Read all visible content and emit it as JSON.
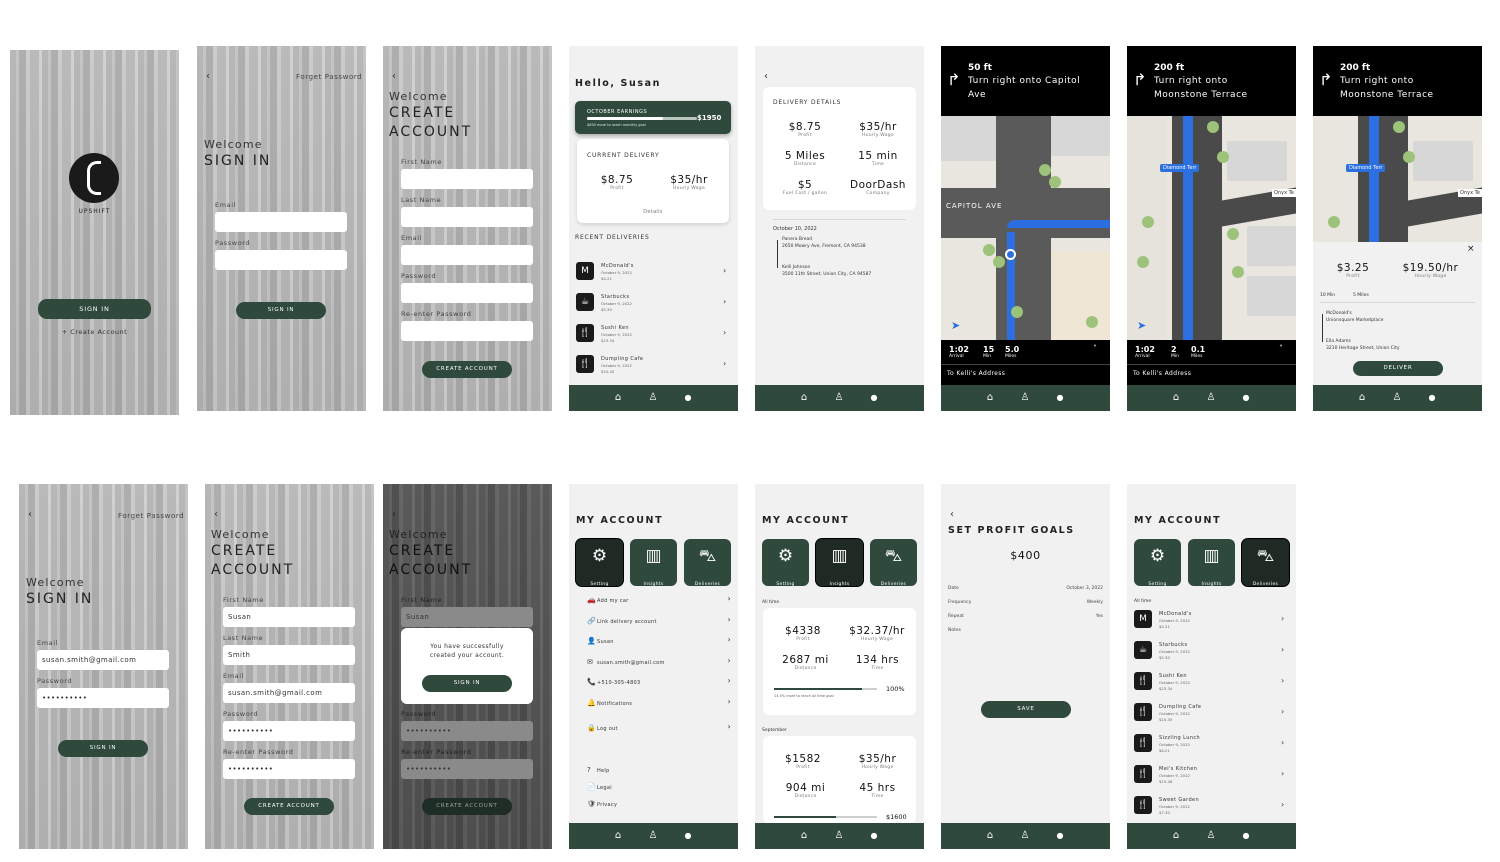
{
  "brand": {
    "name": "UPSHIFT",
    "accent": "#2f4a3c"
  },
  "s1": {
    "signin": "SIGN IN",
    "create": "+ Create Account"
  },
  "s2": {
    "back": "‹",
    "forgot": "Forget Password",
    "welcome": "Welcome",
    "title": "SIGN IN",
    "email_label": "Email",
    "password_label": "Password",
    "button": "SIGN IN"
  },
  "s3": {
    "back": "‹",
    "welcome": "Welcome",
    "title1": "CREATE",
    "title2": "ACCOUNT",
    "labels": [
      "First Name",
      "Last Name",
      "Email",
      "Password",
      "Re-enter Password"
    ],
    "button": "CREATE ACCOUNT"
  },
  "s4": {
    "greeting": "Hello, Susan",
    "earnings_label": "OCTOBER EARNINGS",
    "earnings_value": "$1950",
    "earnings_note": "$850 more to reach monthly goal",
    "earnings_progress": 0.69,
    "current_label": "CURRENT DELIVERY",
    "profit": "$8.75",
    "profit_sub": "Profit",
    "wage": "$35/hr",
    "wage_sub": "Hourly Wage",
    "details": "Details",
    "recent_label": "RECENT DELIVERIES",
    "deliveries": [
      {
        "name": "McDonald's",
        "date": "October 9, 2022",
        "amt": "$4.21",
        "icon": "M"
      },
      {
        "name": "Starbucks",
        "date": "October 9, 2022",
        "amt": "$5.30",
        "icon": "☕"
      },
      {
        "name": "Sushi Ken",
        "date": "October 9, 2022",
        "amt": "$23.34",
        "icon": "🍴"
      },
      {
        "name": "Dumpling Cafe",
        "date": "October 9, 2022",
        "amt": "$10.45",
        "icon": "🍴"
      }
    ]
  },
  "s5": {
    "back": "‹",
    "header": "DELIVERY DETAILS",
    "stats": [
      {
        "v": "$8.75",
        "s": "Profit"
      },
      {
        "v": "$35/hr",
        "s": "Hourly Wage"
      },
      {
        "v": "5 Miles",
        "s": "Distance"
      },
      {
        "v": "15 min",
        "s": "Time"
      },
      {
        "v": "$5",
        "s": "Fuel Cost / gallon"
      },
      {
        "v": "DoorDash",
        "s": "Company"
      }
    ],
    "date": "October 10, 2022",
    "stop1_name": "Panera Bread",
    "stop1_addr": "2650 Mowry Ave, Fremont, CA 94538",
    "stop2_name": "Kelli Johnson",
    "stop2_addr": "3500 11th Street, Union City, CA 94587"
  },
  "s6": {
    "dist": "50 ft",
    "line1": "Turn right onto Capitol",
    "line2": "Ave",
    "street": "CAPITOL AVE",
    "arrival": "1:02",
    "arrival_sub": "Arrival",
    "min": "15",
    "min_sub": "Min",
    "miles": "5.0",
    "miles_sub": "Miles",
    "dest": "To Kelli's Address"
  },
  "s7": {
    "dist": "200 ft",
    "line1": "Turn right onto",
    "line2": "Moonstone Terrace",
    "street": "Diamond Terr",
    "street2": "Onyx Te",
    "arrival": "1:02",
    "arrival_sub": "Arrival",
    "min": "2",
    "min_sub": "Min",
    "miles": "0.1",
    "miles_sub": "Miles",
    "dest": "To Kelli's Address"
  },
  "s8": {
    "dist": "200 ft",
    "line1": "Turn right onto",
    "line2": "Moonstone Terrace",
    "street": "Diamond Terr",
    "street2": "Onyx Te",
    "close": "×",
    "profit": "$3.25",
    "profit_sub": "Profit",
    "wage": "$19.50/hr",
    "wage_sub": "Hourly Wage",
    "mins": "10 Min",
    "miles": "5 Miles",
    "stop1": "McDonald's",
    "stop1_addr": "Unionsquare Marketplace",
    "stop2": "Ella Adams",
    "stop2_addr": "3210 Heritage Street, Union City",
    "button": "DELIVER"
  },
  "s9": {
    "back": "‹",
    "forgot": "Forget Password",
    "welcome": "Welcome",
    "title": "SIGN IN",
    "email_label": "Email",
    "email": "susan.smith@gmail.com",
    "password_label": "Password",
    "password": "••••••••••",
    "button": "SIGN IN"
  },
  "s10": {
    "back": "‹",
    "welcome": "Welcome",
    "title1": "CREATE",
    "title2": "ACCOUNT",
    "labels": [
      "First Name",
      "Last Name",
      "Email",
      "Password",
      "Re-enter Password"
    ],
    "values": [
      "Susan",
      "Smith",
      "susan.smith@gmail.com",
      "••••••••••",
      "••••••••••"
    ],
    "button": "CREATE ACCOUNT"
  },
  "s11": {
    "back": "‹",
    "welcome": "Welcome",
    "title1": "CREATE",
    "title2": "ACCOUNT",
    "first_label": "First Name",
    "first": "Susan",
    "modal_text1": "You have successfully",
    "modal_text2": "created your account.",
    "modal_button": "SIGN IN",
    "password_label": "Password",
    "password": "••••••••••",
    "reenter_label": "Re-enter Password",
    "reenter": "••••••••••",
    "button": "CREATE ACCOUNT"
  },
  "s12": {
    "header": "MY ACCOUNT",
    "tabs": [
      "Setting",
      "Insights",
      "Deliveries"
    ],
    "items": [
      {
        "icon": "🚗",
        "label": "Add my car"
      },
      {
        "icon": "🔗",
        "label": "Link delivery account"
      },
      {
        "icon": "👤",
        "label": "Susan"
      },
      {
        "icon": "✉",
        "label": "susan.smith@gmail.com"
      },
      {
        "icon": "📞",
        "label": "+510-305-4803"
      },
      {
        "icon": "🔔",
        "label": "Notifications"
      },
      {
        "icon": "🔒",
        "label": "Log out"
      }
    ],
    "footer": [
      {
        "icon": "?",
        "label": "Help"
      },
      {
        "icon": "📄",
        "label": "Legal"
      },
      {
        "icon": "🛡",
        "label": "Privacy"
      }
    ]
  },
  "s13": {
    "header": "MY ACCOUNT",
    "tabs": [
      "Setting",
      "Insights",
      "Deliveries"
    ],
    "alltime": "All time",
    "a_profit": "$4338",
    "a_profit_sub": "Profit",
    "a_wage": "$32.37/hr",
    "a_wage_sub": "Hourly Wage",
    "a_dist": "2687 mi",
    "a_dist_sub": "Distance",
    "a_time": "134 hrs",
    "a_time_sub": "Time",
    "a_progress_pct": "100%",
    "a_progress": 1.0,
    "a_note": "14.5% more to reach all time goal",
    "sept": "September",
    "s_profit": "$1582",
    "s_profit_sub": "Profit",
    "s_wage": "$35/hr",
    "s_wage_sub": "Hourly Wage",
    "s_dist": "904 mi",
    "s_dist_sub": "Distance",
    "s_time": "45 hrs",
    "s_time_sub": "Time",
    "s_goal": "$1600",
    "s_progress": 0.95
  },
  "s14": {
    "back": "‹",
    "header": "SET PROFIT GOALS",
    "amount": "$400",
    "date_label": "Date",
    "date": "October 3, 2022",
    "freq_label": "Frequency",
    "freq": "Weekly",
    "repeat_label": "Repeat",
    "repeat": "Yes",
    "notes_label": "Notes",
    "button": "SAVE"
  },
  "s15": {
    "header": "MY ACCOUNT",
    "tabs": [
      "Setting",
      "Insights",
      "Deliveries"
    ],
    "alltime": "All time",
    "deliveries": [
      {
        "name": "McDonald's",
        "date": "October 9, 2022",
        "amt": "$4.21",
        "icon": "M"
      },
      {
        "name": "Starbucks",
        "date": "October 9, 2022",
        "amt": "$5.30",
        "icon": "☕"
      },
      {
        "name": "Sushi Ken",
        "date": "October 9, 2022",
        "amt": "$23.34",
        "icon": "🍴"
      },
      {
        "name": "Dumpling Cafe",
        "date": "October 9, 2022",
        "amt": "$10.45",
        "icon": "🍴"
      },
      {
        "name": "Sizzling Lunch",
        "date": "October 9, 2022",
        "amt": "$8.21",
        "icon": "🍴"
      },
      {
        "name": "Mei's Kitchen",
        "date": "October 9, 2022",
        "amt": "$15.46",
        "icon": "🍴"
      },
      {
        "name": "Sweet Garden",
        "date": "October 9, 2022",
        "amt": "$7.30",
        "icon": "🍴"
      }
    ]
  },
  "nav": {
    "home": "⌂",
    "person": "♙",
    "account": "●"
  }
}
